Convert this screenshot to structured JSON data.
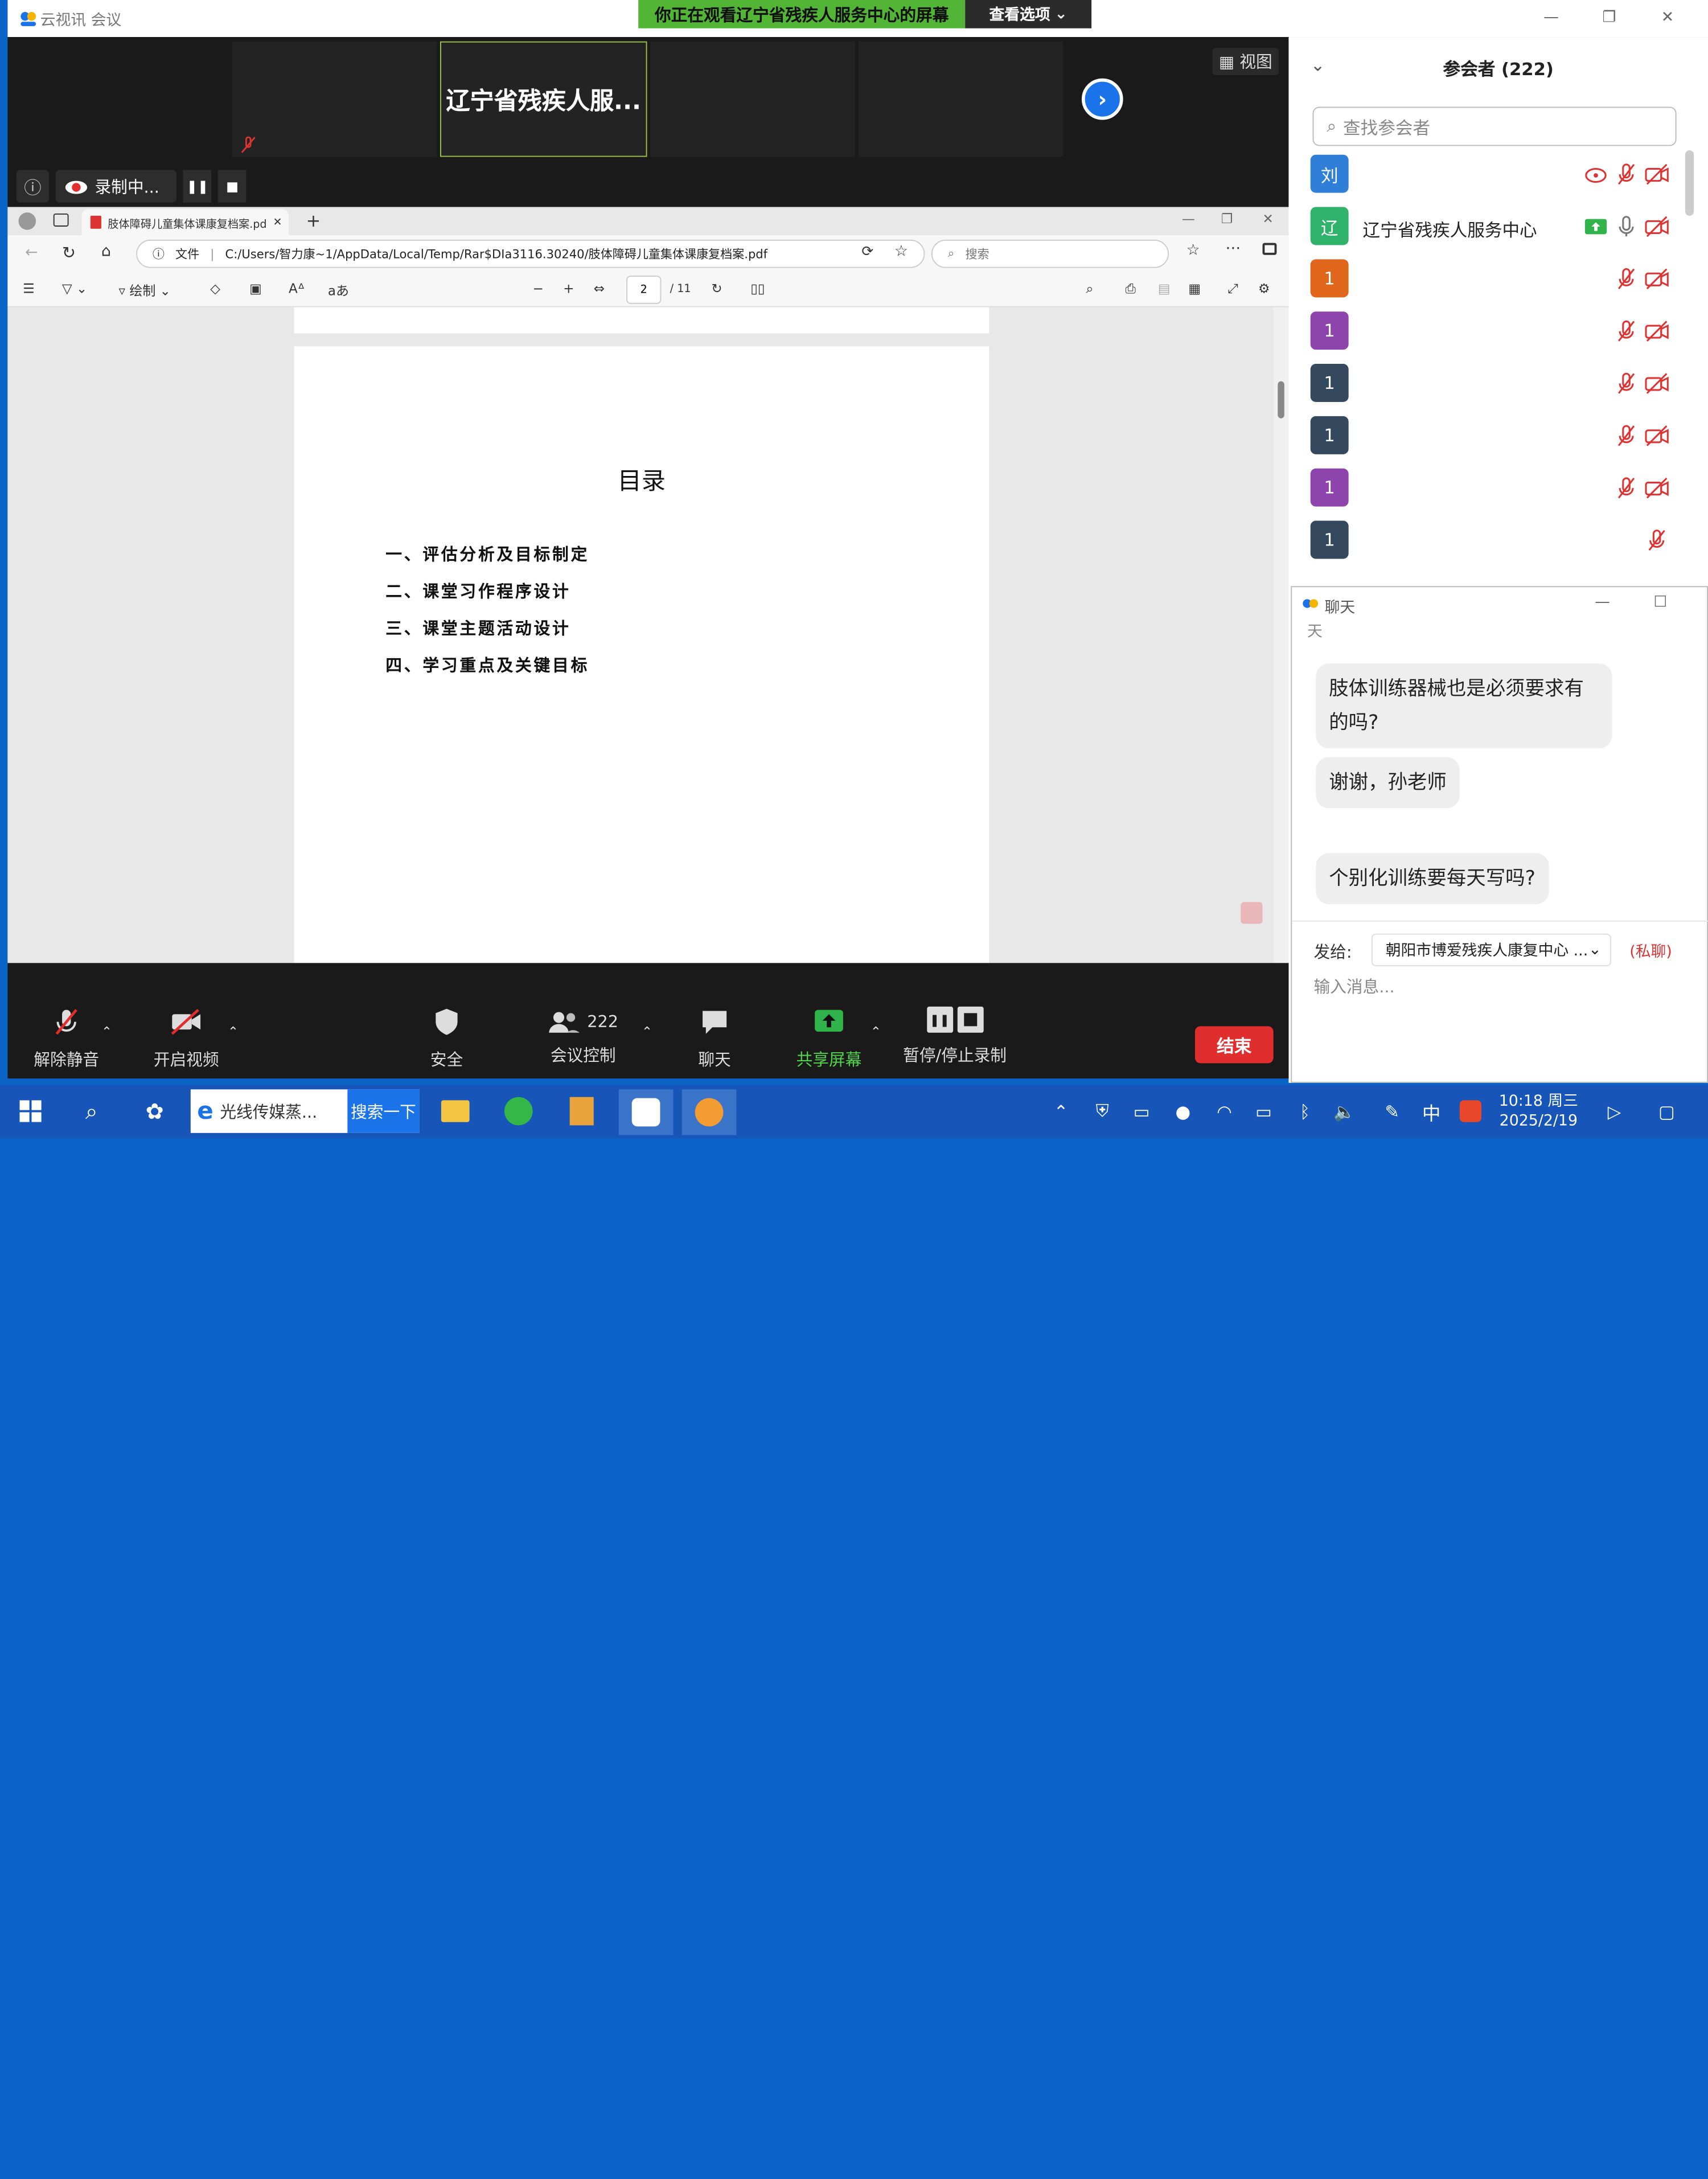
{
  "window": {
    "title": "云视讯 会议",
    "share_message": "你正在观看辽宁省残疾人服务中心的屏幕",
    "view_options": "查看选项"
  },
  "strip": {
    "active_tile_name": "辽宁省残疾人服...",
    "view_label": "视图",
    "recording_label": "录制中..."
  },
  "browser": {
    "tab_title": "肢体障碍儿童集体课康复档案.pdf",
    "url_prefix": "文件",
    "url": "C:/Users/智力康~1/AppData/Local/Temp/Rar$DIa3116.30240/肢体障碍儿童集体课康复档案.pdf",
    "search_placeholder": "搜索",
    "draw_label": "绘制",
    "page_current": "2",
    "page_total": "/ 11"
  },
  "document": {
    "toc_title": "目录",
    "items": [
      "一、评估分析及目标制定",
      "二、课堂习作程序设计",
      "三、课堂主题活动设计",
      "四、学习重点及关键目标"
    ]
  },
  "participants": {
    "title": "参会者 (222)",
    "search_placeholder": "查找参会者",
    "list": [
      {
        "avatar": "刘",
        "name": "",
        "color": "#2f7ed8"
      },
      {
        "avatar": "辽",
        "name": "辽宁省残疾人服务中心",
        "color": "#2fb36b"
      },
      {
        "avatar": "1",
        "name": "",
        "color": "#e0661b"
      },
      {
        "avatar": "1",
        "name": "",
        "color": "#8e44ad"
      },
      {
        "avatar": "1",
        "name": "",
        "color": "#34495e"
      },
      {
        "avatar": "1",
        "name": "",
        "color": "#34495e"
      },
      {
        "avatar": "1",
        "name": "",
        "color": "#8e44ad"
      },
      {
        "avatar": "1",
        "name": "",
        "color": "#34495e"
      }
    ]
  },
  "chat": {
    "title": "聊天",
    "header_fragment": "天",
    "messages": [
      "肢体训练器械也是必须要求有的吗?",
      "谢谢，孙老师",
      "个别化训练要每天写吗?"
    ],
    "send_to_label": "发给:",
    "send_to_value": "朝阳市博爱残疾人康复中心 ...",
    "private_label": "(私聊)",
    "input_placeholder": "输入消息..."
  },
  "toolbar": {
    "unmute": "解除静音",
    "video": "开启视频",
    "security": "安全",
    "participants_count": "222",
    "meeting_control": "会议控制",
    "chat": "聊天",
    "share": "共享屏幕",
    "record": "暂停/停止录制",
    "end": "结束"
  },
  "taskbar": {
    "search_text": "光线传媒蒸...",
    "search_button": "搜索一下",
    "ime": "中",
    "time": "10:18 周三",
    "date": "2025/2/19"
  },
  "colors": {
    "accent_blue": "#1a73e8",
    "end_red": "#e02d2d",
    "share_green": "#53b536",
    "mute_red": "#d33"
  }
}
